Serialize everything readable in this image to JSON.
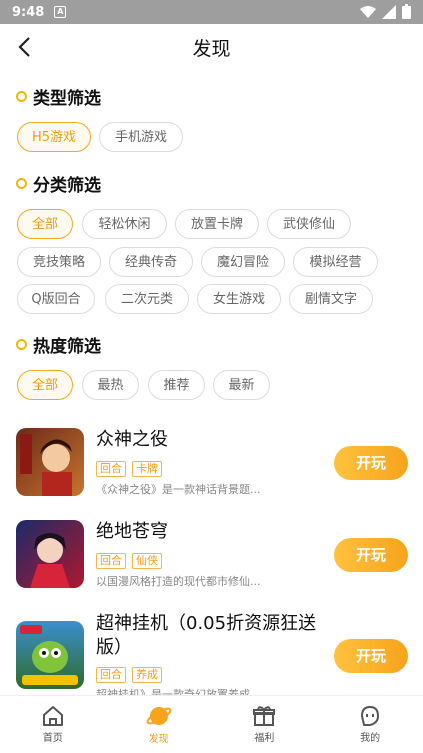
{
  "status": {
    "time": "9:48"
  },
  "header": {
    "title": "发现"
  },
  "type_filter": {
    "title": "类型筛选",
    "options": [
      "H5游戏",
      "手机游戏"
    ],
    "selected": "H5游戏"
  },
  "category_filter": {
    "title": "分类筛选",
    "options": [
      "全部",
      "轻松休闲",
      "放置卡牌",
      "武侠修仙",
      "竞技策略",
      "经典传奇",
      "魔幻冒险",
      "模拟经营",
      "Q版回合",
      "二次元类",
      "女生游戏",
      "剧情文字"
    ],
    "selected": "全部"
  },
  "heat_filter": {
    "title": "热度筛选",
    "options": [
      "全部",
      "最热",
      "推荐",
      "最新"
    ],
    "selected": "全部"
  },
  "games": [
    {
      "name": "众神之役",
      "tags": [
        "回合",
        "卡牌"
      ],
      "desc": "《众神之役》是一款神话背景题...",
      "button": "开玩"
    },
    {
      "name": "绝地苍穹",
      "tags": [
        "回合",
        "仙侠"
      ],
      "desc": "以国漫风格打造的现代都市修仙...",
      "button": "开玩"
    },
    {
      "name": "超神挂机（0.05折资源狂送版）",
      "tags": [
        "回合",
        "养成"
      ],
      "desc": "超神挂机》是一款奇幻放置养成...",
      "button": "开玩"
    }
  ],
  "tabbar": {
    "items": [
      "首页",
      "发现",
      "福利",
      "我的"
    ],
    "active": "发现"
  },
  "colors": {
    "accent": "#f7a31c",
    "accent_light": "#ffc23d"
  }
}
